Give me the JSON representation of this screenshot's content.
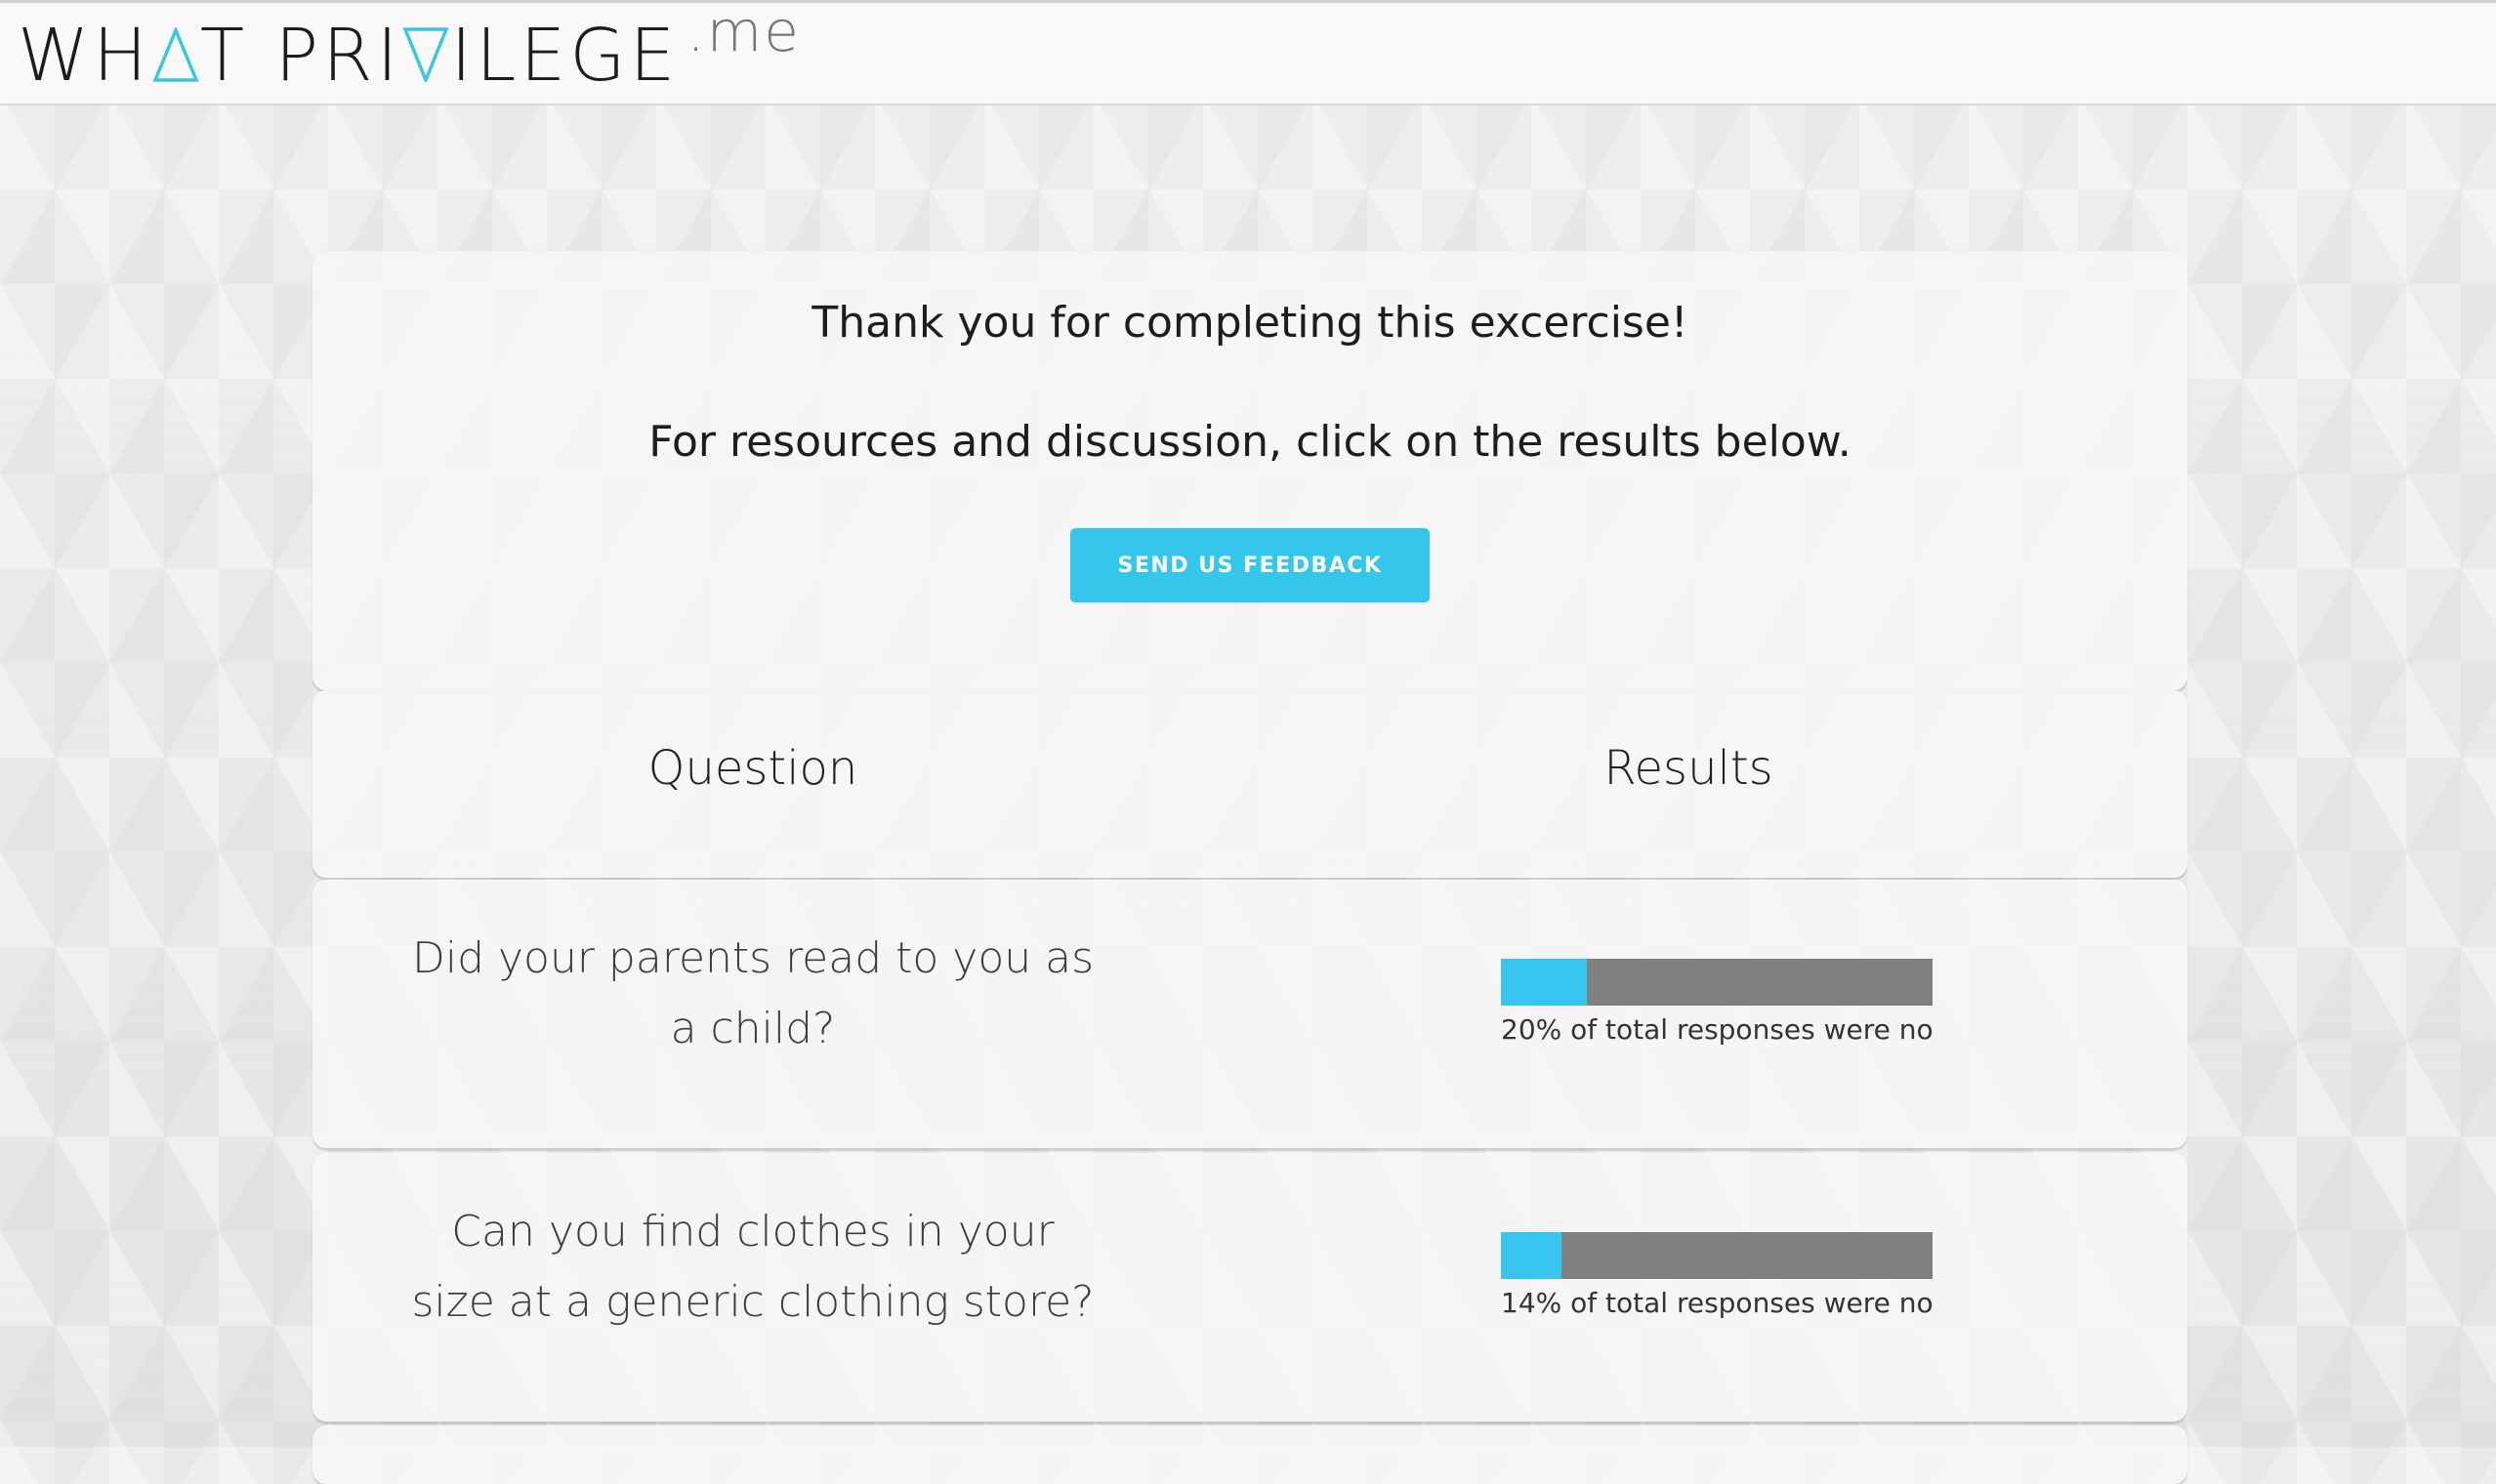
{
  "header": {
    "logo_left": "WH",
    "logo_after_first_triangle": "T PRI",
    "logo_after_second_triangle": "ILEGE",
    "logo_suffix": ".me",
    "accent_color": "#3ec6dc"
  },
  "intro": {
    "thanks": "Thank you for completing this excercise!",
    "resources": "For resources and discussion, click on the results below.",
    "feedback_button": "SEND US FEEDBACK",
    "button_color": "#35c6ec"
  },
  "table_header": {
    "question": "Question",
    "results": "Results"
  },
  "questions": [
    {
      "text": "Did your parents read to you as a child?",
      "percent_no": 20,
      "caption": "20% of total responses were no"
    },
    {
      "text": "Can you find clothes in your size at a generic clothing store?",
      "percent_no": 14,
      "caption": "14% of total responses were no"
    }
  ],
  "colors": {
    "bar_fill": "#38c6ee",
    "bar_track": "#808080"
  }
}
